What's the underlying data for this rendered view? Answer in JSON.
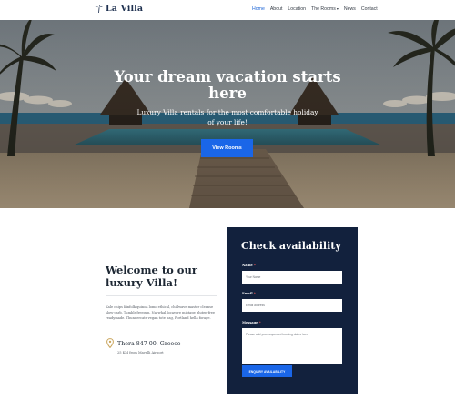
{
  "brand": {
    "name": "La Villa"
  },
  "nav": {
    "items": [
      {
        "label": "Home",
        "active": true
      },
      {
        "label": "About",
        "active": false
      },
      {
        "label": "Location",
        "active": false
      },
      {
        "label": "The Rooms",
        "active": false,
        "has_dropdown": true
      },
      {
        "label": "News",
        "active": false
      },
      {
        "label": "Contact",
        "active": false
      }
    ]
  },
  "hero": {
    "title": "Your dream vacation starts here",
    "subtitle": "Luxury Villa rentals for the most comfortable holiday of your life!",
    "button_label": "View Rooms"
  },
  "welcome": {
    "title": "Welcome to our luxury Villa!",
    "body": "Kale chips Kinfolk quinoa lomo ethical, chillwave master cleanse slow-carb, Tumblr freegan. Narwhal locavore mixtape gluten-free readymade. Thundercats vegan tote bag, Portland hella forage.",
    "location_title": "Thera 847 00, Greece",
    "location_subtitle": "25 KM from Mavelli Airport"
  },
  "availability": {
    "title": "Check availability",
    "name_label": "Name",
    "name_placeholder": "Your Name",
    "email_label": "Email",
    "email_placeholder": "Email address",
    "message_label": "Message",
    "message_placeholder": "Please add your requested booking dates here",
    "submit_label": "ENQUIRY AVAILABILITY"
  },
  "colors": {
    "accent": "#1a66e8",
    "card_background": "#12213d",
    "brand_text": "#1f3150"
  }
}
